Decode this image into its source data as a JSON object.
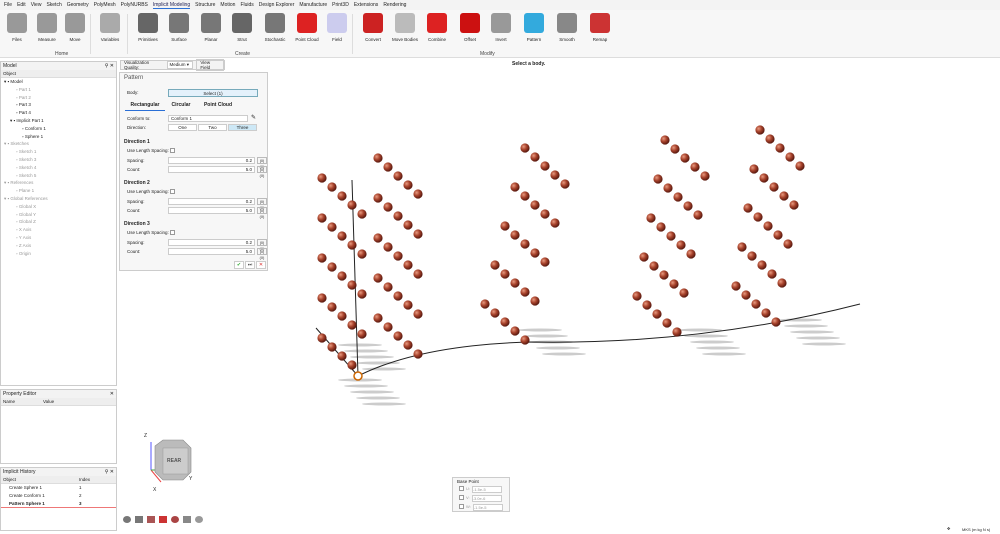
{
  "menu": [
    "File",
    "Edit",
    "View",
    "Sketch",
    "Geometry",
    "PolyMesh",
    "PolyNURBS",
    "Implicit Modeling",
    "Structure",
    "Motion",
    "Fluids",
    "Design Explorer",
    "Manufacture",
    "Print3D",
    "Extensions",
    "Rendering"
  ],
  "ribbon": {
    "home": [
      "Files",
      "Measure",
      "Move"
    ],
    "variables": "Variables",
    "home_label": "Home",
    "create": [
      "Primitives",
      "Surface",
      "Planar",
      "Strut",
      "Stochastic",
      "Point Cloud",
      "Field"
    ],
    "create_label": "Create",
    "modify": [
      "Convert",
      "Move Bodies",
      "Combine",
      "Offset",
      "Invert",
      "Pattern",
      "Smooth",
      "Remap"
    ],
    "modify_label": "Modify"
  },
  "status_hint": "Select a body.",
  "model_panel": {
    "title": "Model",
    "col": "Object",
    "items": [
      {
        "label": "Model",
        "level": 0,
        "dim": false
      },
      {
        "label": "Part 1",
        "level": 2,
        "dim": true
      },
      {
        "label": "Part 2",
        "level": 2,
        "dim": true
      },
      {
        "label": "Part 3",
        "level": 2,
        "dim": false
      },
      {
        "label": "Part 4",
        "level": 2,
        "dim": false
      },
      {
        "label": "Implicit Part 1",
        "level": 1,
        "dim": false
      },
      {
        "label": "Conform 1",
        "level": 3,
        "dim": false
      },
      {
        "label": "Sphere 1",
        "level": 3,
        "dim": false
      },
      {
        "label": "Sketches",
        "level": 0,
        "dim": true
      },
      {
        "label": "Sketch 1",
        "level": 2,
        "dim": true
      },
      {
        "label": "Sketch 3",
        "level": 2,
        "dim": true
      },
      {
        "label": "Sketch 4",
        "level": 2,
        "dim": true
      },
      {
        "label": "Sketch 5",
        "level": 2,
        "dim": true
      },
      {
        "label": "References",
        "level": 0,
        "dim": true
      },
      {
        "label": "Plane 1",
        "level": 2,
        "dim": true
      },
      {
        "label": "Global References",
        "level": 0,
        "dim": true
      },
      {
        "label": "Global X",
        "level": 2,
        "dim": true
      },
      {
        "label": "Global Y",
        "level": 2,
        "dim": true
      },
      {
        "label": "Global Z",
        "level": 2,
        "dim": true
      },
      {
        "label": "X Axis",
        "level": 2,
        "dim": true
      },
      {
        "label": "Y Axis",
        "level": 2,
        "dim": true
      },
      {
        "label": "Z Axis",
        "level": 2,
        "dim": true
      },
      {
        "label": "Origin",
        "level": 2,
        "dim": true
      }
    ]
  },
  "viz": {
    "label": "Visualization Quality:",
    "value": "Medium",
    "view_field": "View Field"
  },
  "pattern": {
    "title": "Pattern",
    "body_label": "Body:",
    "body_value": "Select (1)",
    "tabs": [
      "Rectangular",
      "Circular",
      "Point Cloud"
    ],
    "conform_label": "Conform to:",
    "conform_value": "Conform 1",
    "direction_label": "Direction:",
    "directions": [
      "One",
      "Two",
      "Three"
    ],
    "active_direction": "Three",
    "dirs": [
      {
        "title": "Direction 1",
        "uls": "Use Length Spacing:",
        "spacing_label": "Spacing:",
        "spacing": "0.2",
        "count_label": "Count:",
        "count": "5.0",
        "unit": "(0)(X)"
      },
      {
        "title": "Direction 2",
        "uls": "Use Length Spacing:",
        "spacing_label": "Spacing:",
        "spacing": "0.2",
        "count_label": "Count:",
        "count": "5.0",
        "unit": "(0)(X)"
      },
      {
        "title": "Direction 3",
        "uls": "Use Length Spacing:",
        "spacing_label": "Spacing:",
        "spacing": "0.2",
        "count_label": "Count:",
        "count": "5.0",
        "unit": "(0)(X)"
      }
    ]
  },
  "property_editor": {
    "title": "Property Editor",
    "cols": [
      "Name",
      "Value"
    ]
  },
  "history": {
    "title": "Implicit History",
    "cols": [
      "Object",
      "Index"
    ],
    "rows": [
      {
        "object": "Create Sphere 1",
        "index": "1"
      },
      {
        "object": "Create Conform 1",
        "index": "2"
      },
      {
        "object": "Pattern Sphere 1",
        "index": "3"
      }
    ]
  },
  "viewcube": {
    "face": "REAR",
    "x": "X",
    "y": "Y",
    "z": "Z"
  },
  "base_point": {
    "title": "Base Point",
    "fields": [
      {
        "label": "U:",
        "value": "-1.5e-5"
      },
      {
        "label": "V:",
        "value": "-3.0e-6"
      },
      {
        "label": "W:",
        "value": "-1.5e-5"
      }
    ]
  },
  "units": "MKS (m kg N s)",
  "colors": {
    "sphere": "#a8432c",
    "accent": "#2a6fd6"
  }
}
